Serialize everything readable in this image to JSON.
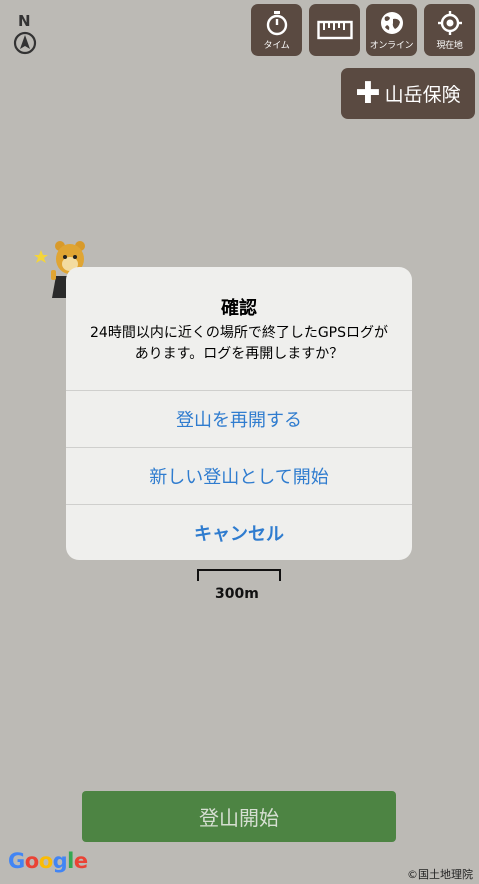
{
  "compass": {
    "letter": "N"
  },
  "toolbar": {
    "timer_label": "タイム",
    "online_label": "オンライン",
    "location_label": "現在地"
  },
  "insurance_button": {
    "label": "山岳保険"
  },
  "dialog": {
    "title": "確認",
    "message": "24時間以内に近くの場所で終了したGPSログがあります。ログを再開しますか？",
    "actions": {
      "resume": "登山を再開する",
      "new_climb": "新しい登山として開始",
      "cancel": "キャンセル"
    }
  },
  "scale": {
    "label": "300m"
  },
  "start_button": {
    "label": "登山開始"
  },
  "google_logo": {
    "letters": [
      "G",
      "o",
      "o",
      "g",
      "l",
      "e"
    ]
  },
  "attribution": "©国土地理院",
  "colors": {
    "map_background": "#bcbab5",
    "toolbar_brown": "#5a4a41",
    "dialog_background": "#efefed",
    "action_blue": "#2f7ccf",
    "start_green": "#4d8443"
  }
}
